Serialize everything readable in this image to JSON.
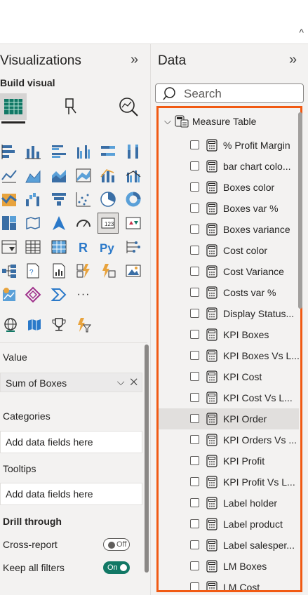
{
  "topbar": {
    "chevron": "^"
  },
  "visualizations": {
    "title": "Visualizations",
    "collapse_icon": "»",
    "build_label": "Build visual",
    "wells": {
      "value_title": "Value",
      "value_field": "Sum of Boxes",
      "categories_title": "Categories",
      "categories_placeholder": "Add data fields here",
      "tooltips_title": "Tooltips",
      "tooltips_placeholder": "Add data fields here"
    },
    "drill": {
      "title": "Drill through",
      "cross_report": "Cross-report",
      "cross_report_state": "Off",
      "keep_filters": "Keep all filters",
      "keep_filters_state": "On"
    },
    "more_visuals": "···"
  },
  "data_pane": {
    "title": "Data",
    "collapse_icon": "»",
    "search_placeholder": "Search",
    "table_name": "Measure Table",
    "fields": [
      "% Profit Margin",
      "bar chart colo...",
      "Boxes color",
      "Boxes var %",
      "Boxes variance",
      "Cost color",
      "Cost Variance",
      "Costs var %",
      "Display Status...",
      "KPI Boxes",
      "KPI Boxes Vs L...",
      "KPI Cost",
      "KPI Cost Vs L...",
      "KPI Order",
      "KPI Orders Vs ...",
      "KPI Profit",
      "KPI Profit Vs L...",
      "Label holder",
      "Label product",
      "Label salesper...",
      "LM Boxes",
      "LM Cost"
    ]
  },
  "colors": {
    "accent_border": "#f15a13",
    "toggle_on": "#117865"
  }
}
